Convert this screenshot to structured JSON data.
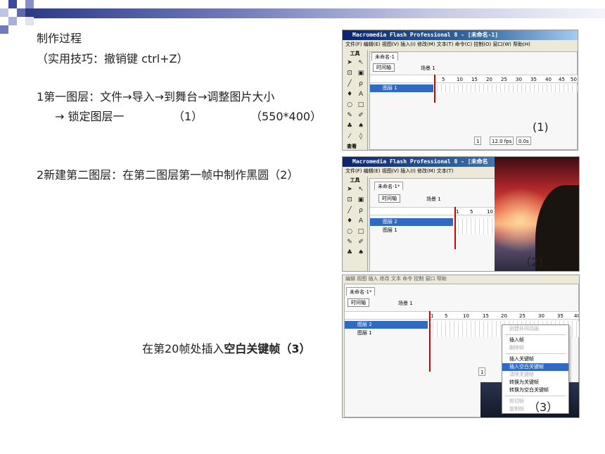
{
  "slide": {
    "heading": "制作过程",
    "tip": "（实用技巧：撤销键 ctrl+Z）",
    "step1_line1": "1第一图层：文件→导入→到舞台→调整图片大小",
    "step1_line2": "→ 锁定图层一",
    "step1_ref": "（1）",
    "step1_size": "（550*400）",
    "step2": "2新建第二图层：在第二图层第一帧中制作黑圆（2）",
    "step3_prefix": "在第20帧处插入",
    "step3_bold": "空白关键帧（3）"
  },
  "shot1": {
    "window_title": "Macromedia Flash Professional 8 - [未命名-1]",
    "menu": "文件(F)  编辑(E)  视图(V)  插入(I)  修改(M)  文本(T)  命令(C)  控制(O)  窗口(W)  帮助(H)",
    "toolbox_title": "工具",
    "toolbox_view": "查看",
    "doc_tab": "未命名-1",
    "timeline_btn": "时间轴",
    "scene": "场景 1",
    "ruler": [
      "5",
      "10",
      "15",
      "20",
      "25",
      "30",
      "35",
      "40",
      "45",
      "50"
    ],
    "layer1": "图层 1",
    "frame": "1",
    "fps": "12.0 fps",
    "time": "0.0s",
    "caption": "(1)"
  },
  "shot2": {
    "window_title": "Macromedia Flash Professional 8 - [未命名",
    "menu": "文件(F)  编辑(E)  视图(V)  插入(I)  修改(M)  文本(T)",
    "toolbox_title": "工具",
    "doc_tab": "未命名-1*",
    "timeline_btn": "时间轴",
    "scene": "场景 1",
    "ruler": [
      "1",
      "5",
      "10"
    ],
    "layer2": "图层 2",
    "layer1": "图层 1",
    "caption": "（2）"
  },
  "shot3": {
    "menu": "编辑   视图   插入   修改   文本   命令   控制   窗口   帮助",
    "doc_tab": "未命名-1*",
    "timeline_btn": "时间轴",
    "scene": "场景 1",
    "ruler": [
      "1",
      "5",
      "10",
      "15",
      "20",
      "25",
      "30",
      "35",
      "40"
    ],
    "layer2": "图层 2",
    "layer1": "图层 1",
    "frame": "1",
    "caption": "（3）",
    "context_menu": [
      {
        "label": "创建补间动画",
        "state": "dim"
      },
      {
        "label": "",
        "state": "sep"
      },
      {
        "label": "插入帧",
        "state": "normal"
      },
      {
        "label": "删除帧",
        "state": "dim"
      },
      {
        "label": "",
        "state": "sep"
      },
      {
        "label": "插入关键帧",
        "state": "normal"
      },
      {
        "label": "插入空白关键帧",
        "state": "hl"
      },
      {
        "label": "清除关键帧",
        "state": "dim"
      },
      {
        "label": "转换为关键帧",
        "state": "normal"
      },
      {
        "label": "转换为空白关键帧",
        "state": "normal"
      },
      {
        "label": "",
        "state": "sep"
      },
      {
        "label": "剪切帧",
        "state": "dim"
      },
      {
        "label": "复制帧",
        "state": "dim"
      }
    ]
  }
}
